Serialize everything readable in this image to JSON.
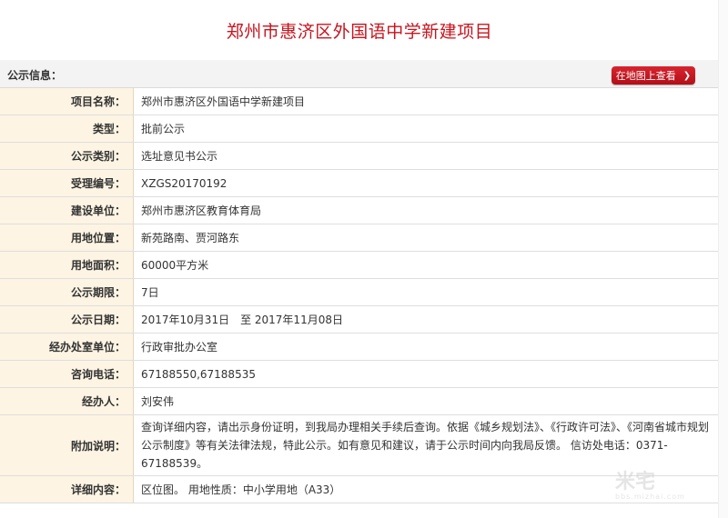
{
  "page": {
    "title": "郑州市惠济区外国语中学新建项目"
  },
  "section": {
    "label": "公示信息：",
    "map_button": "在地图上查看"
  },
  "rows": [
    {
      "label": "项目名称：",
      "value": "郑州市惠济区外国语中学新建项目"
    },
    {
      "label": "类型：",
      "value": "批前公示"
    },
    {
      "label": "公示类别：",
      "value": "选址意见书公示"
    },
    {
      "label": "受理编号：",
      "value": "XZGS20170192"
    },
    {
      "label": "建设单位：",
      "value": "郑州市惠济区教育体育局"
    },
    {
      "label": "用地位置：",
      "value": "新苑路南、贾河路东"
    },
    {
      "label": "用地面积：",
      "value": "60000平方米"
    },
    {
      "label": "公示期限：",
      "value": "7日"
    },
    {
      "label": "公示日期：",
      "value": "2017年10月31日　至 2017年11月08日"
    },
    {
      "label": "经办处室单位：",
      "value": "行政审批办公室"
    },
    {
      "label": "咨询电话：",
      "value": "67188550,67188535"
    },
    {
      "label": "经办人：",
      "value": "刘安伟"
    },
    {
      "label": "附加说明：",
      "value": "查询详细内容，请出示身份证明，到我局办理相关手续后查询。依据《城乡规划法》、《行政许可法》、《河南省城市规划公示制度》等有关法律法规，特此公示。如有意见和建议，请于公示时间内向我局反馈。 信访处电话：0371-67188539。"
    },
    {
      "label": "详细内容：",
      "value": "区位图。 用地性质：中小学用地（A33）"
    }
  ],
  "watermark": {
    "main": "米宅",
    "sub": "bbs.mizhai.com"
  }
}
